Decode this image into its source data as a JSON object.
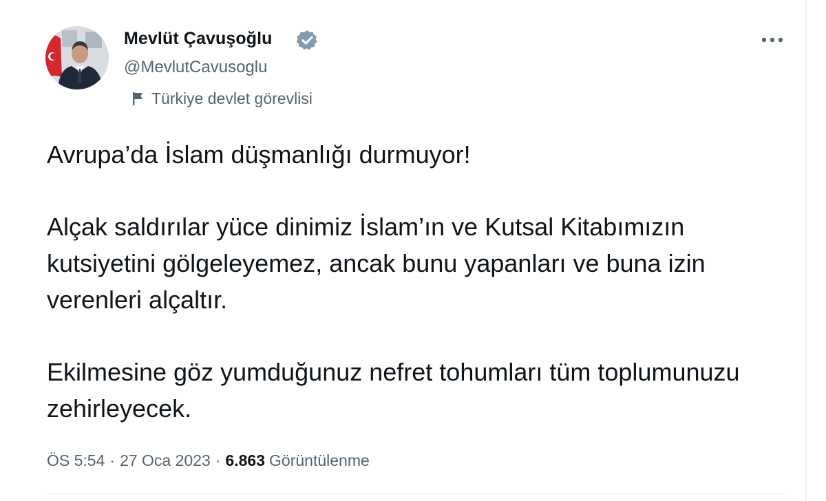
{
  "author": {
    "display_name": "Mevlüt Çavuşoğlu",
    "handle": "@MevlutCavusoglu",
    "label": "Türkiye devlet görevlisi",
    "verified_badge_color": "#829aab"
  },
  "tweet": {
    "paragraphs": [
      "Avrupa’da İslam düşmanlığı durmuyor!",
      "Alçak saldırılar yüce dinimiz İslam’ın ve Kutsal Kitabımızın kutsiyetini gölgeleyemez, ancak bunu yapanları ve buna izin verenleri alçaltır.",
      "Ekilmesine göz yumduğunuz nefret tohumları tüm toplumunuzu zehirleyecek."
    ]
  },
  "meta": {
    "time": "ÖS 5:54",
    "separator": "·",
    "date": "27 Oca 2023",
    "views_count": "6.863",
    "views_label": "Görüntülenme"
  },
  "icons": {
    "verified": "verified-badge-icon",
    "more": "more-options-icon",
    "label": "flag-icon"
  },
  "colors": {
    "text_primary": "#0f1419",
    "text_secondary": "#536471",
    "background": "#ffffff"
  }
}
